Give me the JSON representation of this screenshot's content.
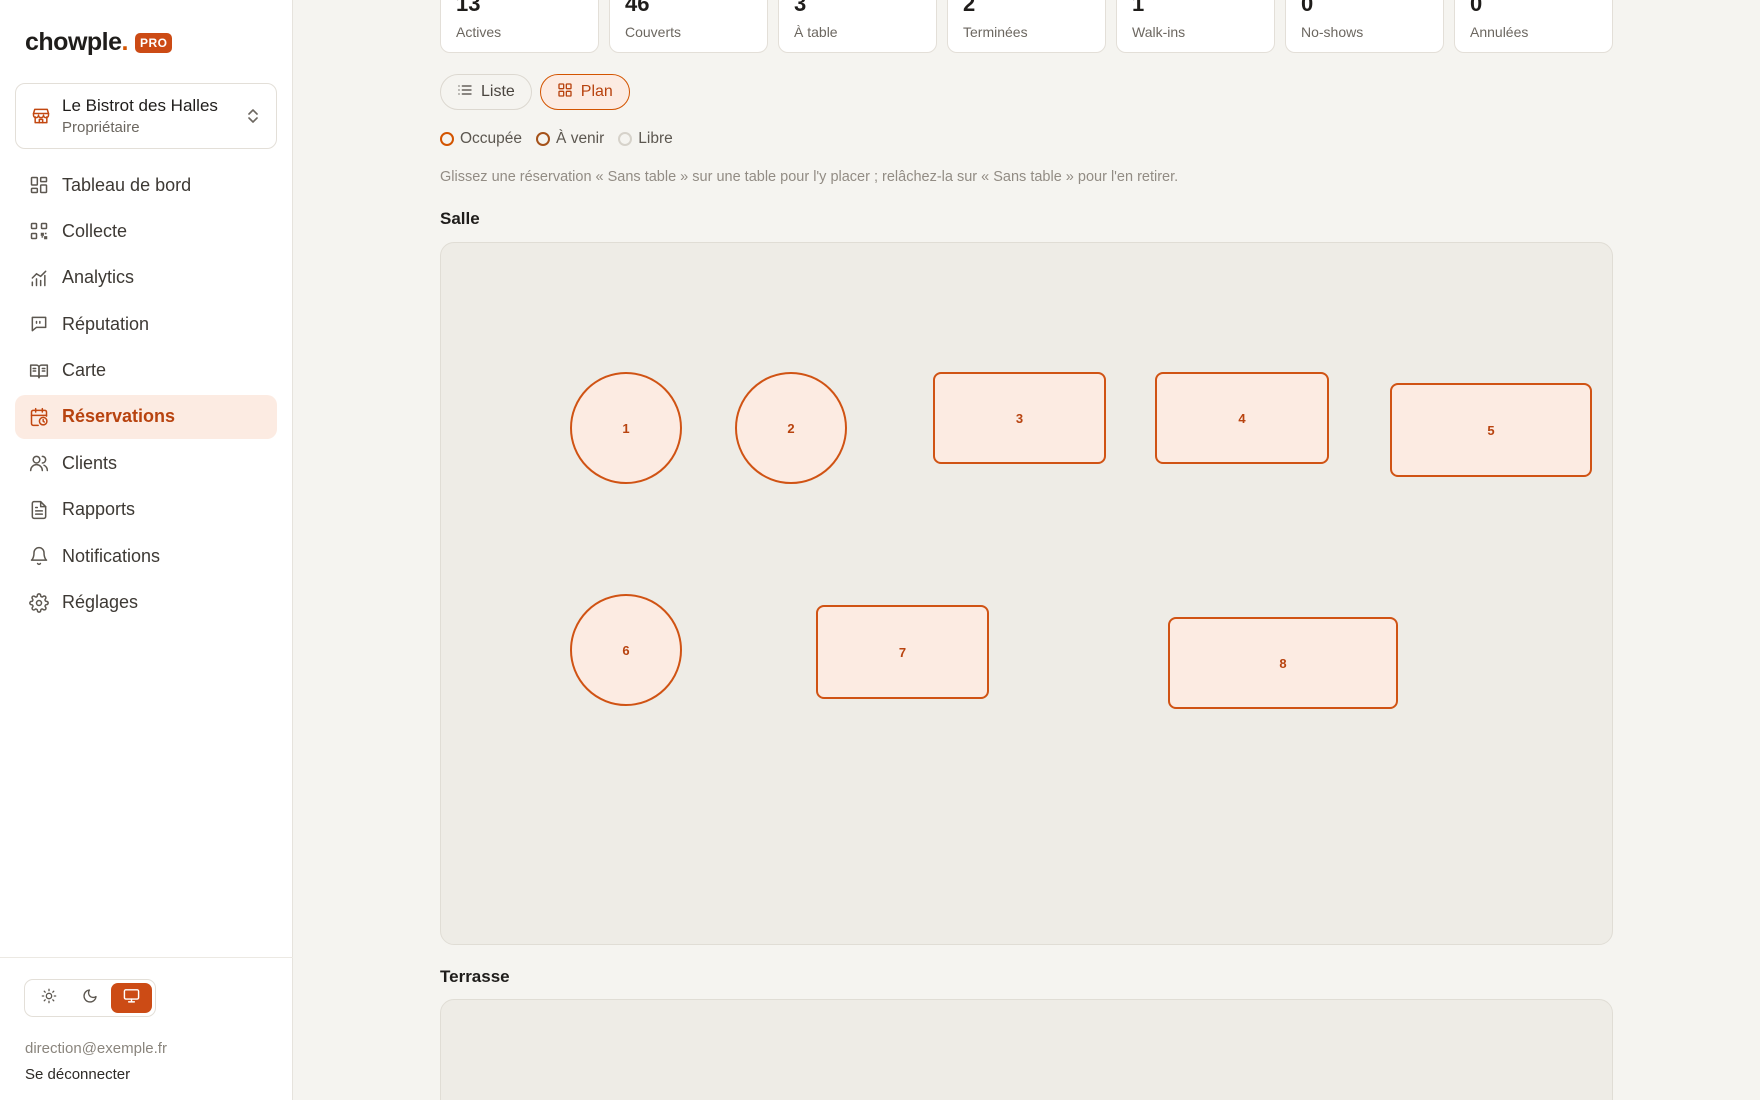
{
  "brand": {
    "name": "chowple",
    "dot": ".",
    "badge": "PRO"
  },
  "venue": {
    "name": "Le Bistrot des Halles",
    "role": "Propriétaire"
  },
  "nav": [
    {
      "label": "Tableau de bord",
      "icon": "dashboard-icon"
    },
    {
      "label": "Collecte",
      "icon": "qr-code-icon"
    },
    {
      "label": "Analytics",
      "icon": "bar-chart-icon"
    },
    {
      "label": "Réputation",
      "icon": "message-quote-icon"
    },
    {
      "label": "Carte",
      "icon": "book-open-icon"
    },
    {
      "label": "Réservations",
      "icon": "calendar-clock-icon",
      "active": true
    },
    {
      "label": "Clients",
      "icon": "users-icon"
    },
    {
      "label": "Rapports",
      "icon": "file-text-icon"
    },
    {
      "label": "Notifications",
      "icon": "bell-icon"
    },
    {
      "label": "Réglages",
      "icon": "gear-icon"
    }
  ],
  "footer": {
    "email": "direction@exemple.fr",
    "logout": "Se déconnecter",
    "theme_active": "system"
  },
  "stats": [
    {
      "value": "13",
      "label": "Actives"
    },
    {
      "value": "46",
      "label": "Couverts"
    },
    {
      "value": "3",
      "label": "À table"
    },
    {
      "value": "2",
      "label": "Terminées"
    },
    {
      "value": "1",
      "label": "Walk-ins"
    },
    {
      "value": "0",
      "label": "No-shows"
    },
    {
      "value": "0",
      "label": "Annulées"
    }
  ],
  "view_toggle": {
    "list": "Liste",
    "plan": "Plan",
    "active": "plan"
  },
  "legend": {
    "occupied": "Occupée",
    "upcoming": "À venir",
    "free": "Libre"
  },
  "hint": "Glissez une réservation « Sans table » sur une table pour l'y placer ; relâchez-la sur « Sans table » pour l'en retirer.",
  "sections": {
    "salle": "Salle",
    "terrasse": "Terrasse"
  },
  "tables": [
    "1",
    "2",
    "3",
    "4",
    "5",
    "6",
    "7",
    "8"
  ],
  "colors": {
    "accent": "#cc4b15",
    "accent_light": "#fcebe2",
    "background": "#f5f4f0"
  }
}
